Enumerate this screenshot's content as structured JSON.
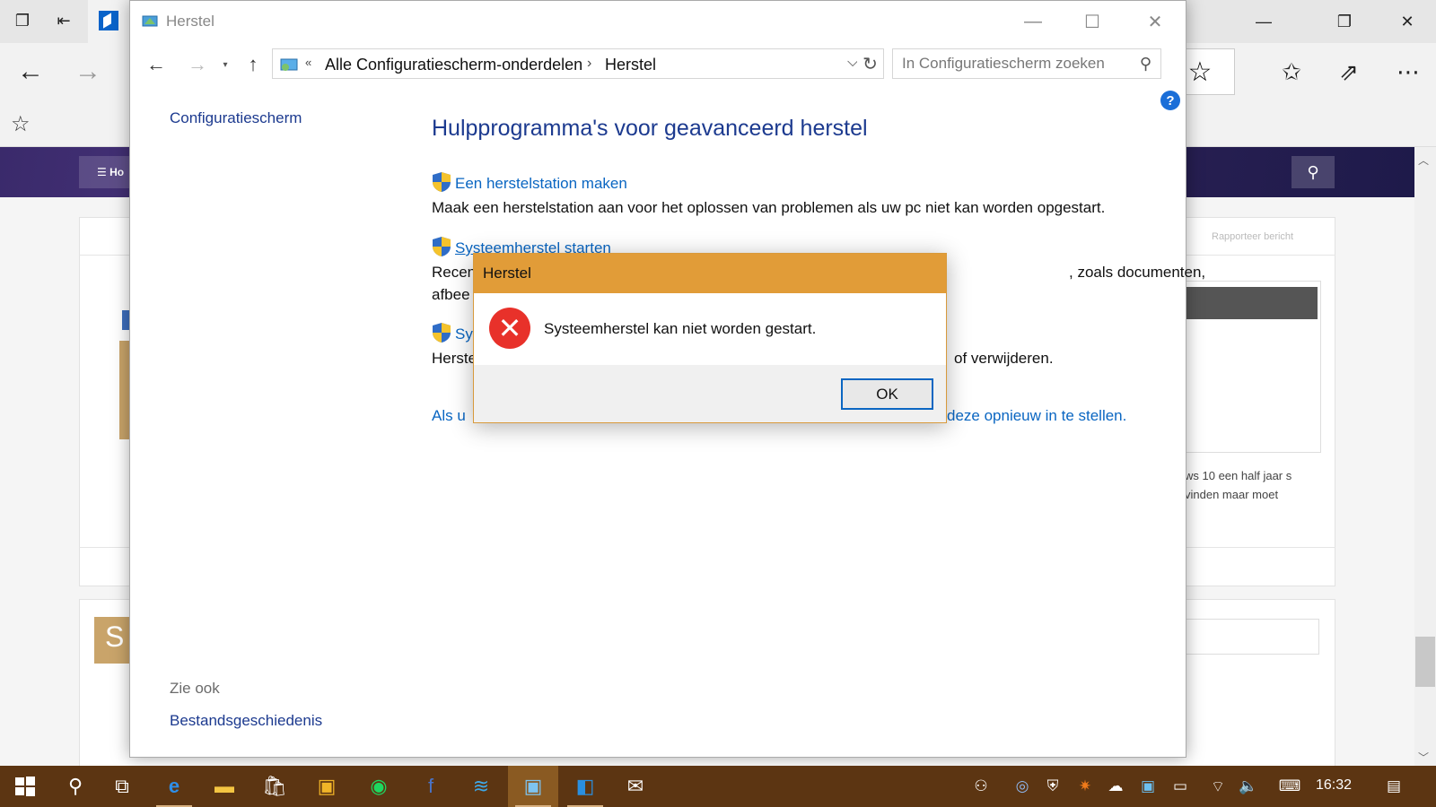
{
  "browser": {
    "favorites_star": "☆"
  },
  "site": {
    "menu_label": "Ho",
    "report_link": "Rapporteer bericht",
    "sidebar_text": "ws 10 een half jaar s vinden maar moet",
    "block_letter": "S"
  },
  "window": {
    "title": "Herstel",
    "address": {
      "prefix": "«",
      "crumbs": [
        "Alle Configuratiescherm-onderdelen",
        "Herstel"
      ],
      "separator": "›"
    },
    "search": {
      "placeholder": "In Configuratiescherm zoeken"
    },
    "help_label": "?",
    "sidebar": {
      "home_link": "Configuratiescherm",
      "see_also_label": "Zie ook",
      "see_also_links": [
        "Bestandsgeschiedenis"
      ]
    },
    "main": {
      "heading": "Hulpprogramma's voor geavanceerd herstel",
      "items": [
        {
          "link": "Een herstelstation maken",
          "description_lines": [
            "Maak een herstelstation aan voor het oplossen van problemen als uw pc niet kan worden opgestart."
          ]
        },
        {
          "link": "Systeemherstel starten",
          "description_lines": [
            "Recen",
            "afbee"
          ],
          "description_tail": ", zoals documenten,"
        },
        {
          "link": "Sy",
          "description_lines": [
            "Herste"
          ],
          "description_tail": "of verwijderen."
        }
      ],
      "bottom_link_start": "Als u",
      "bottom_link_end": "deze opnieuw in te stellen."
    }
  },
  "dialog": {
    "title": "Herstel",
    "message": "Systeemherstel kan niet worden gestart.",
    "ok_label": "OK"
  },
  "taskbar": {
    "clock": "16:32"
  },
  "colors": {
    "dialog_titlebar": "#e19c38",
    "taskbar": "#5c3512",
    "link": "#0a66c2",
    "heading": "#1c3a8f",
    "error_icon": "#e8312a"
  }
}
